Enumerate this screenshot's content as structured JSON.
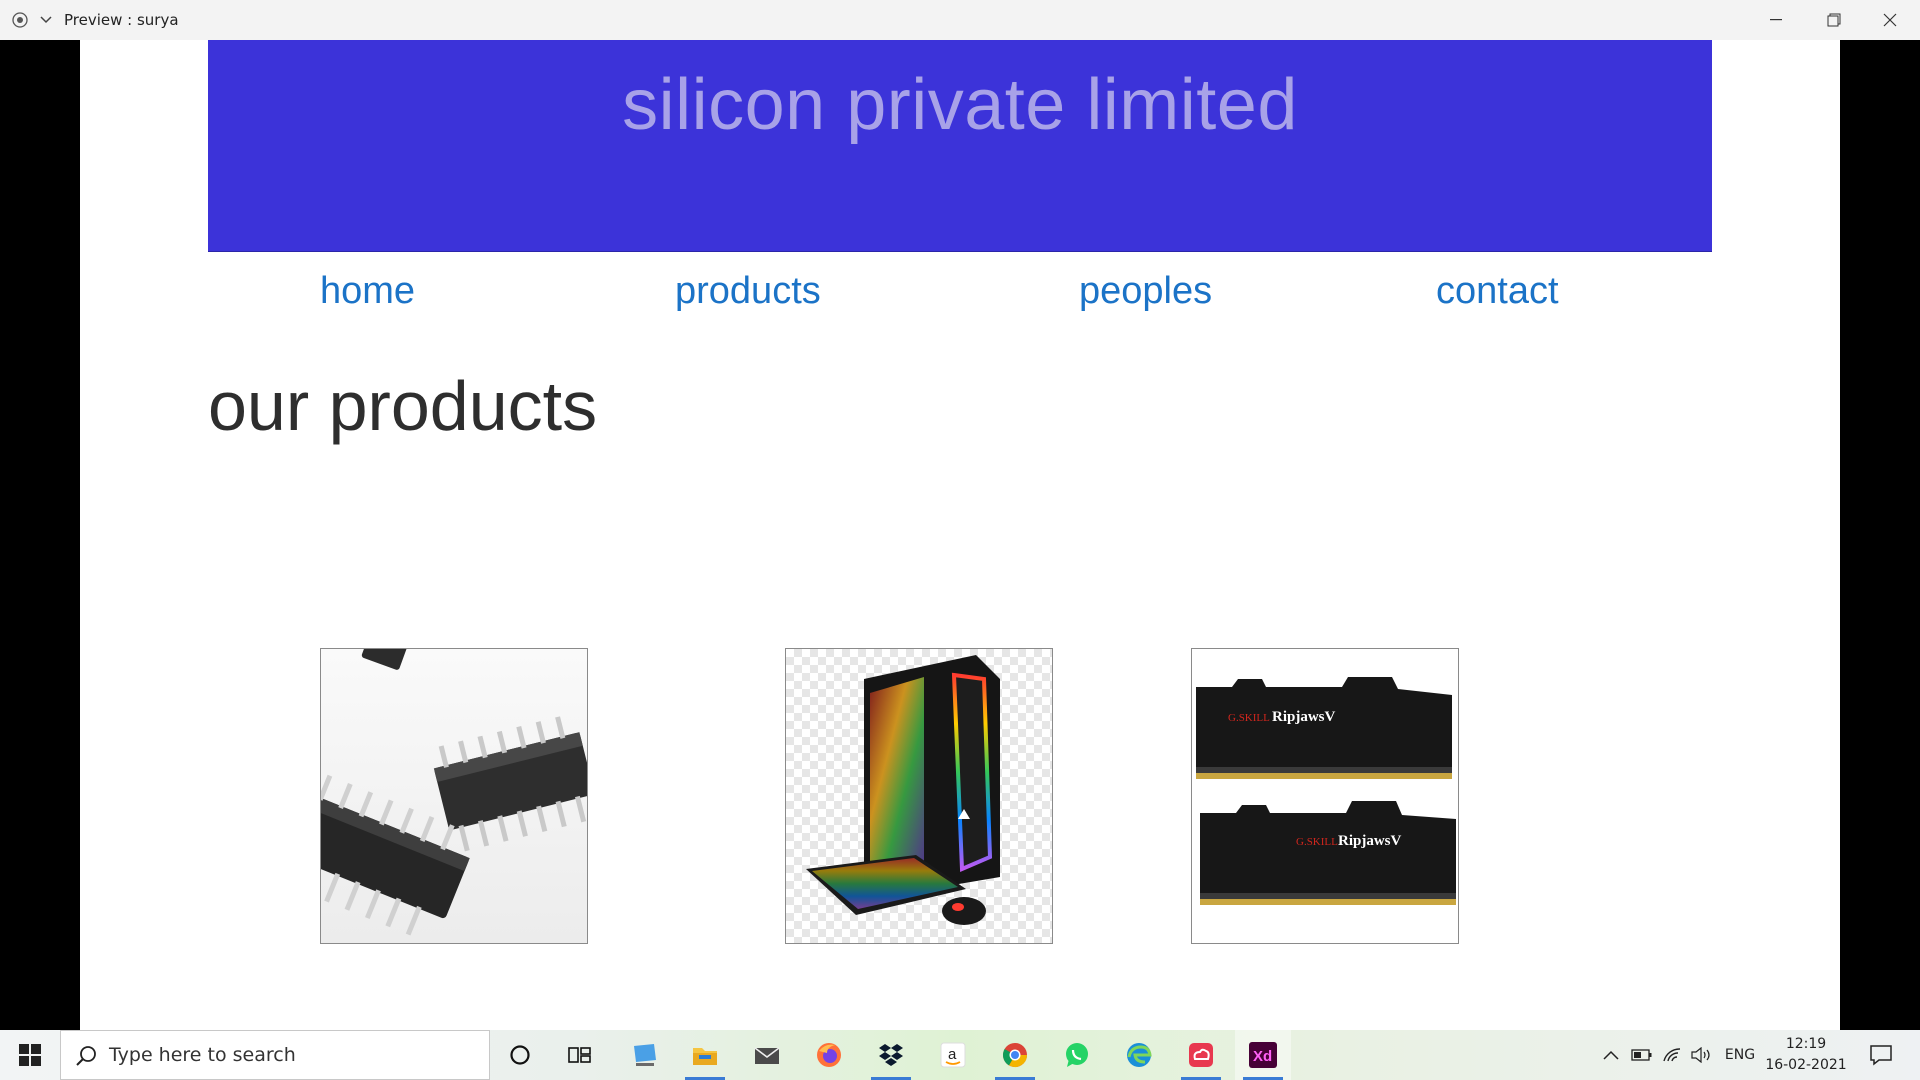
{
  "window": {
    "title": "Preview : surya"
  },
  "site": {
    "banner_title": "silicon private limited",
    "nav": [
      "home",
      "products",
      "peoples",
      "contact"
    ],
    "section_title": "our products"
  },
  "products": [
    {
      "icon": "ic-chip-icon"
    },
    {
      "icon": "gaming-pc-icon"
    },
    {
      "icon": "ram-module-icon",
      "label_top": "RipjawsV",
      "label_bottom": "RipjawsV"
    }
  ],
  "taskbar": {
    "search_placeholder": "Type here to search",
    "apps": [
      "cortana-icon",
      "task-view-icon",
      "desktop-icon",
      "file-explorer-icon",
      "mail-icon",
      "firefox-icon",
      "dropbox-icon",
      "amazon-icon",
      "chrome-icon",
      "whatsapp-icon",
      "edge-icon",
      "creative-cloud-icon",
      "adobe-xd-icon"
    ],
    "xd_label": "Xd",
    "language": "ENG",
    "time": "12:19",
    "date": "16-02-2021"
  },
  "colors": {
    "banner": "#3c33d9",
    "nav_link": "#1b73c7"
  }
}
